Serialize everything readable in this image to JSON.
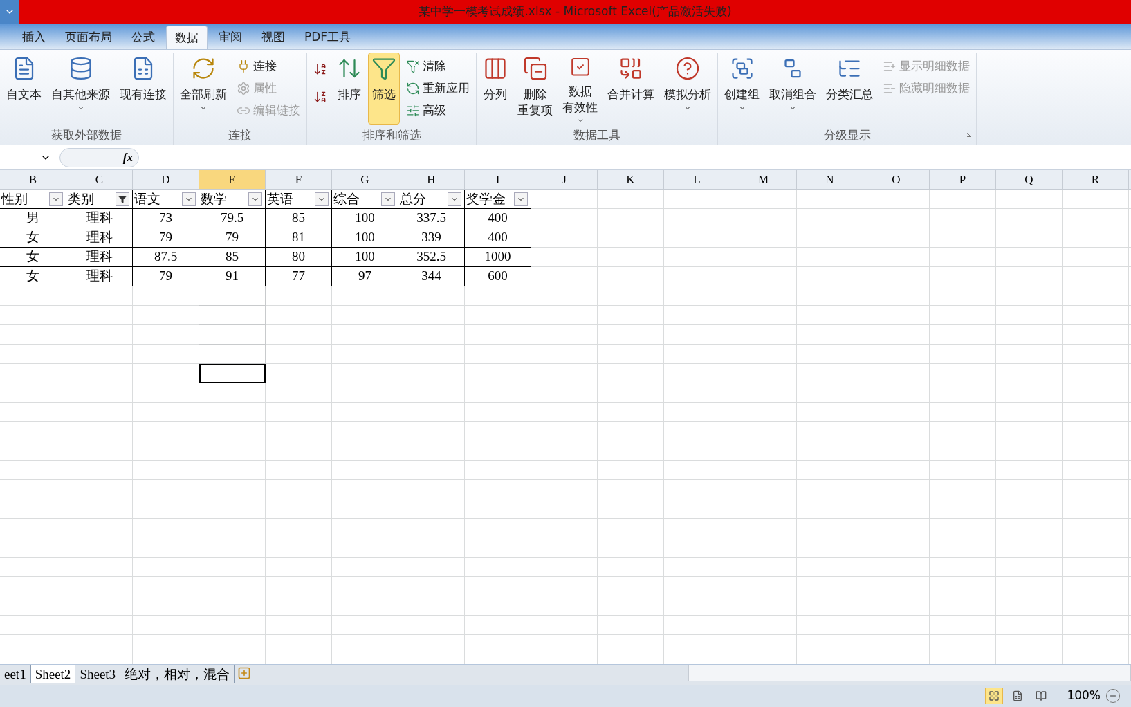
{
  "window": {
    "title": "某中学一模考试成绩.xlsx - Microsoft Excel(产品激活失败)"
  },
  "tabs": [
    {
      "label": "插入",
      "selected": false
    },
    {
      "label": "页面布局",
      "selected": false
    },
    {
      "label": "公式",
      "selected": false
    },
    {
      "label": "数据",
      "selected": true
    },
    {
      "label": "审阅",
      "selected": false
    },
    {
      "label": "视图",
      "selected": false
    },
    {
      "label": "PDF工具",
      "selected": false
    }
  ],
  "ribbon": [
    {
      "label": "获取外部数据",
      "items": [
        {
          "kind": "large",
          "lines": [
            "自文本"
          ],
          "disabled": false,
          "selected": false
        },
        {
          "kind": "large",
          "lines": [
            "自其他来源"
          ],
          "disabled": false,
          "dropdown": true,
          "selected": false
        },
        {
          "kind": "large",
          "lines": [
            "现有连接"
          ],
          "disabled": false,
          "selected": false
        }
      ]
    },
    {
      "label": "连接",
      "items": [
        {
          "kind": "large",
          "lines": [
            "全部刷新"
          ],
          "disabled": false,
          "dropdown": true,
          "selected": false
        },
        {
          "kind": "small",
          "lines": [
            "连接"
          ],
          "disabled": false,
          "selected": false
        },
        {
          "kind": "small",
          "lines": [
            "属性"
          ],
          "disabled": true,
          "selected": false
        },
        {
          "kind": "small",
          "lines": [
            "编辑链接"
          ],
          "disabled": true,
          "selected": false
        }
      ]
    },
    {
      "label": "排序和筛选",
      "items": [
        {
          "kind": "icon",
          "disabled": false,
          "selected": false
        },
        {
          "kind": "icon",
          "disabled": false,
          "selected": false
        },
        {
          "kind": "large",
          "lines": [
            "排序"
          ],
          "disabled": false,
          "selected": false
        },
        {
          "kind": "large",
          "lines": [
            "筛选"
          ],
          "disabled": false,
          "selected": true
        },
        {
          "kind": "small",
          "lines": [
            "清除"
          ],
          "disabled": false,
          "selected": false
        },
        {
          "kind": "small",
          "lines": [
            "重新应用"
          ],
          "disabled": false,
          "selected": false
        },
        {
          "kind": "small",
          "lines": [
            "高级"
          ],
          "disabled": false,
          "selected": false
        }
      ]
    },
    {
      "label": "数据工具",
      "items": [
        {
          "kind": "large",
          "lines": [
            "分列"
          ],
          "disabled": false,
          "selected": false
        },
        {
          "kind": "large",
          "lines": [
            "删除",
            "重复项"
          ],
          "disabled": false,
          "selected": false
        },
        {
          "kind": "large",
          "lines": [
            "数据",
            "有效性"
          ],
          "disabled": false,
          "dropdown": true,
          "selected": false
        },
        {
          "kind": "large",
          "lines": [
            "合并计算"
          ],
          "disabled": false,
          "selected": false
        },
        {
          "kind": "large",
          "lines": [
            "模拟分析"
          ],
          "disabled": false,
          "dropdown": true,
          "selected": false
        }
      ]
    },
    {
      "label": "分级显示",
      "dialog_launcher": true,
      "items": [
        {
          "kind": "large",
          "lines": [
            "创建组"
          ],
          "disabled": false,
          "dropdown": true,
          "selected": false
        },
        {
          "kind": "large",
          "lines": [
            "取消组合"
          ],
          "disabled": false,
          "dropdown": true,
          "selected": false
        },
        {
          "kind": "large",
          "lines": [
            "分类汇总"
          ],
          "disabled": false,
          "selected": false
        },
        {
          "kind": "small",
          "lines": [
            "显示明细数据"
          ],
          "disabled": true,
          "selected": false
        },
        {
          "kind": "small",
          "lines": [
            "隐藏明细数据"
          ],
          "disabled": true,
          "selected": false
        }
      ]
    }
  ],
  "formula_bar": {
    "function_label": "fx"
  },
  "columns": [
    {
      "label": "B",
      "selected": false
    },
    {
      "label": "C",
      "selected": false
    },
    {
      "label": "D",
      "selected": false
    },
    {
      "label": "E",
      "selected": true
    },
    {
      "label": "F",
      "selected": false
    },
    {
      "label": "G",
      "selected": false
    },
    {
      "label": "H",
      "selected": false
    },
    {
      "label": "I",
      "selected": false
    },
    {
      "label": "J",
      "selected": false
    },
    {
      "label": "K",
      "selected": false
    },
    {
      "label": "L",
      "selected": false
    },
    {
      "label": "M",
      "selected": false
    },
    {
      "label": "N",
      "selected": false
    },
    {
      "label": "O",
      "selected": false
    },
    {
      "label": "P",
      "selected": false
    },
    {
      "label": "Q",
      "selected": false
    },
    {
      "label": "R",
      "selected": false
    }
  ],
  "table": {
    "headers": [
      {
        "text": "性别",
        "filter_active": false
      },
      {
        "text": "类别",
        "filter_active": true
      },
      {
        "text": "语文",
        "filter_active": false
      },
      {
        "text": "数学",
        "filter_active": false
      },
      {
        "text": "英语",
        "filter_active": false
      },
      {
        "text": "综合",
        "filter_active": false
      },
      {
        "text": "总分",
        "filter_active": false
      },
      {
        "text": "奖学金",
        "filter_active": false
      }
    ],
    "rows": [
      [
        "男",
        "理科",
        "73",
        "79.5",
        "85",
        "100",
        "337.5",
        "400"
      ],
      [
        "女",
        "理科",
        "79",
        "79",
        "81",
        "100",
        "339",
        "400"
      ],
      [
        "女",
        "理科",
        "87.5",
        "85",
        "80",
        "100",
        "352.5",
        "1000"
      ],
      [
        "女",
        "理科",
        "79",
        "91",
        "77",
        "97",
        "344",
        "600"
      ]
    ]
  },
  "empty_rows": [
    {
      "selected": false
    },
    {
      "selected": false
    },
    {
      "selected": false
    },
    {
      "selected": false
    },
    {
      "selected": true
    }
  ],
  "sheet_tabs": [
    {
      "label": "eet1",
      "selected": false
    },
    {
      "label": "Sheet2",
      "selected": true
    },
    {
      "label": "Sheet3",
      "selected": false
    },
    {
      "label": "绝对，相对，混合",
      "selected": false
    }
  ],
  "status_bar": {
    "views": [
      {
        "selected": true
      },
      {
        "selected": false
      },
      {
        "selected": false
      }
    ],
    "zoom": "100%"
  }
}
